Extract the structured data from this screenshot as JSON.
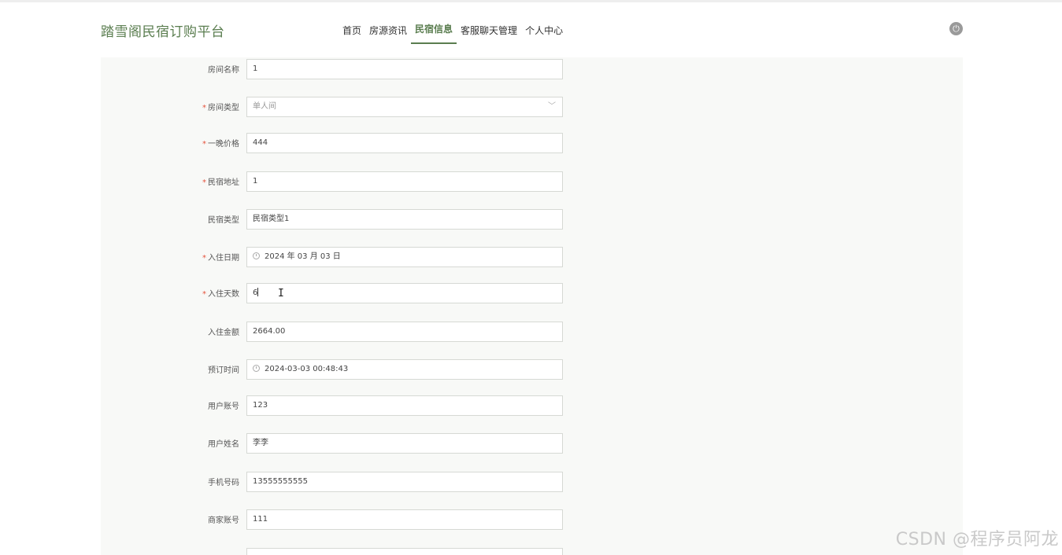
{
  "app": {
    "brand": "踏雪阁民宿订购平台"
  },
  "nav": {
    "items": [
      {
        "label": "首页"
      },
      {
        "label": "房源资讯"
      },
      {
        "label": "民宿信息"
      },
      {
        "label": "客服聊天管理"
      },
      {
        "label": "个人中心"
      }
    ],
    "active_index": 2
  },
  "icons": {
    "power": "power-icon",
    "select": "chevron-down-icon",
    "date": "clock-icon"
  },
  "colors": {
    "accent": "#5a7d4f",
    "required": "#e5533d"
  },
  "form": {
    "fields": [
      {
        "label": "房间名称",
        "required": false,
        "value": "1"
      },
      {
        "label": "房间类型",
        "required": true,
        "value": "单人间"
      },
      {
        "label": "一晚价格",
        "required": true,
        "value": "444"
      },
      {
        "label": "民宿地址",
        "required": true,
        "value": "1"
      },
      {
        "label": "民宿类型",
        "required": false,
        "value": "民宿类型1"
      },
      {
        "label": "入住日期",
        "required": true,
        "value": "2024 年 03 月 03 日"
      },
      {
        "label": "入住天数",
        "required": true,
        "value": "6"
      },
      {
        "label": "入住金额",
        "required": false,
        "value": "2664.00"
      },
      {
        "label": "预订时间",
        "required": false,
        "value": "2024-03-03 00:48:43"
      },
      {
        "label": "用户账号",
        "required": false,
        "value": "123"
      },
      {
        "label": "用户姓名",
        "required": false,
        "value": "李李"
      },
      {
        "label": "手机号码",
        "required": false,
        "value": "13555555555"
      },
      {
        "label": "商家账号",
        "required": false,
        "value": "111"
      }
    ]
  },
  "watermark": "CSDN @程序员阿龙"
}
